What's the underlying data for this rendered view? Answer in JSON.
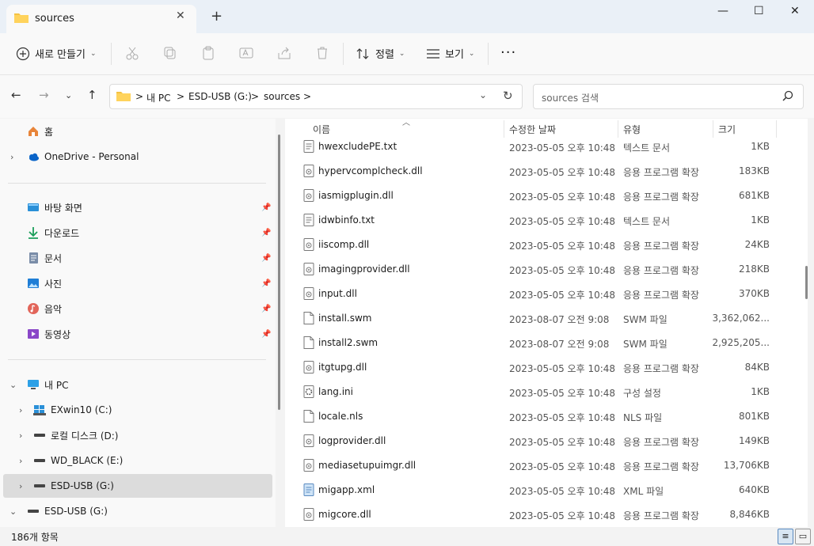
{
  "tab": {
    "title": "sources",
    "close": "✕",
    "new_tab": "+"
  },
  "window": {
    "minimize": "—",
    "maximize": "☐",
    "close": "✕"
  },
  "toolbar": {
    "new_label": "새로 만들기",
    "sort_label": "정렬",
    "view_label": "보기",
    "more": "···"
  },
  "address": {
    "crumbs": [
      "내 PC",
      "ESD-USB (G:)",
      "sources"
    ],
    "sep": ">"
  },
  "search": {
    "placeholder": "sources 검색"
  },
  "sidebar": {
    "home": "홈",
    "onedrive": "OneDrive - Personal",
    "quick": [
      "바탕 화면",
      "다운로드",
      "문서",
      "사진",
      "음악",
      "동영상"
    ],
    "pc": "내 PC",
    "drives": [
      "EXwin10 (C:)",
      "로컬 디스크 (D:)",
      "WD_BLACK (E:)",
      "ESD-USB (G:)"
    ],
    "usb_root": "ESD-USB (G:)"
  },
  "columns": {
    "name": "이름",
    "date": "수정한 날짜",
    "type": "유형",
    "size": "크기"
  },
  "files": [
    {
      "name": "hwexcludePE.txt",
      "date": "2023-05-05 오후 10:48",
      "type": "텍스트 문서",
      "size": "1KB",
      "kind": "txt"
    },
    {
      "name": "hypervcomplcheck.dll",
      "date": "2023-05-05 오후 10:48",
      "type": "응용 프로그램 확장",
      "size": "183KB",
      "kind": "dll"
    },
    {
      "name": "iasmigplugin.dll",
      "date": "2023-05-05 오후 10:48",
      "type": "응용 프로그램 확장",
      "size": "681KB",
      "kind": "dll"
    },
    {
      "name": "idwbinfo.txt",
      "date": "2023-05-05 오후 10:48",
      "type": "텍스트 문서",
      "size": "1KB",
      "kind": "txt"
    },
    {
      "name": "iiscomp.dll",
      "date": "2023-05-05 오후 10:48",
      "type": "응용 프로그램 확장",
      "size": "24KB",
      "kind": "dll"
    },
    {
      "name": "imagingprovider.dll",
      "date": "2023-05-05 오후 10:48",
      "type": "응용 프로그램 확장",
      "size": "218KB",
      "kind": "dll"
    },
    {
      "name": "input.dll",
      "date": "2023-05-05 오후 10:48",
      "type": "응용 프로그램 확장",
      "size": "370KB",
      "kind": "dll"
    },
    {
      "name": "install.swm",
      "date": "2023-08-07 오전 9:08",
      "type": "SWM 파일",
      "size": "3,362,062...",
      "kind": "file"
    },
    {
      "name": "install2.swm",
      "date": "2023-08-07 오전 9:08",
      "type": "SWM 파일",
      "size": "2,925,205...",
      "kind": "file"
    },
    {
      "name": "itgtupg.dll",
      "date": "2023-05-05 오후 10:48",
      "type": "응용 프로그램 확장",
      "size": "84KB",
      "kind": "dll"
    },
    {
      "name": "lang.ini",
      "date": "2023-05-05 오후 10:48",
      "type": "구성 설정",
      "size": "1KB",
      "kind": "ini"
    },
    {
      "name": "locale.nls",
      "date": "2023-05-05 오후 10:48",
      "type": "NLS 파일",
      "size": "801KB",
      "kind": "file"
    },
    {
      "name": "logprovider.dll",
      "date": "2023-05-05 오후 10:48",
      "type": "응용 프로그램 확장",
      "size": "149KB",
      "kind": "dll"
    },
    {
      "name": "mediasetupuimgr.dll",
      "date": "2023-05-05 오후 10:48",
      "type": "응용 프로그램 확장",
      "size": "13,706KB",
      "kind": "dll"
    },
    {
      "name": "migapp.xml",
      "date": "2023-05-05 오후 10:48",
      "type": "XML 파일",
      "size": "640KB",
      "kind": "xml"
    },
    {
      "name": "migcore.dll",
      "date": "2023-05-05 오후 10:48",
      "type": "응용 프로그램 확장",
      "size": "8,846KB",
      "kind": "dll"
    }
  ],
  "status": {
    "count": "186개 항목"
  },
  "colors": {
    "accent": "#0067c0",
    "folder": "#f5c242",
    "selected": "#dcdcdc"
  }
}
